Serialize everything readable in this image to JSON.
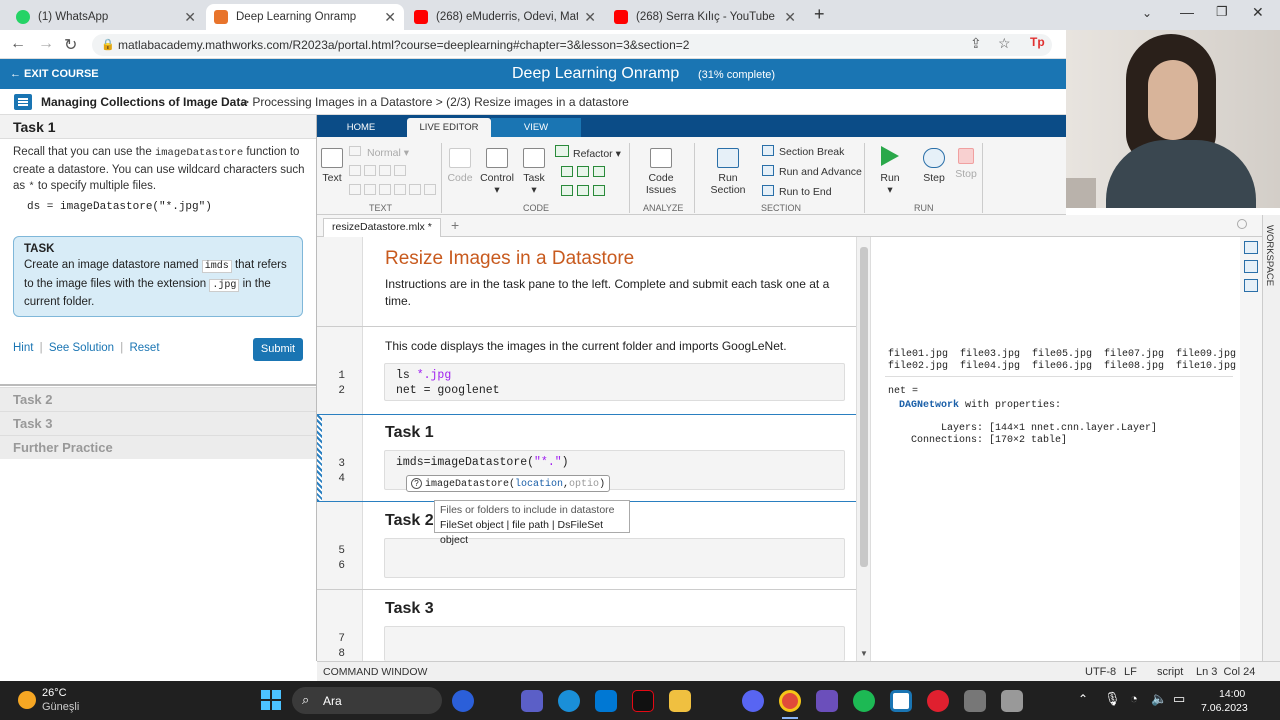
{
  "browser": {
    "tabs": [
      {
        "label": "(1) WhatsApp",
        "color": "#25d366"
      },
      {
        "label": "Deep Learning Onramp",
        "color": "#e8742c"
      },
      {
        "label": "(268) eMuderris, Ödevi, Matlab d",
        "color": "#ff0000"
      },
      {
        "label": "(268) Serra Kılıç - YouTube",
        "color": "#ff0000"
      }
    ],
    "url": "matlabacademy.mathworks.com/R2023a/portal.html?course=deeplearning#chapter=3&lesson=3&section=2"
  },
  "course": {
    "exit_label": "← EXIT COURSE",
    "title": "Deep Learning Onramp",
    "progress": "(31% complete)",
    "breadcrumb_bold": "Managing Collections of Image Data",
    "breadcrumb_rest": "> Processing Images in a Datastore > (2/3) Resize images in a datastore"
  },
  "left_pane": {
    "task_heading": "Task 1",
    "recall_1": "Recall that you can use the",
    "recall_code": "imageDatastore",
    "recall_2": "function to create a datastore. You can use wildcard characters such as",
    "recall_star": "*",
    "recall_3": "to specify multiple files.",
    "example_code": "ds = imageDatastore(\"*.jpg\")",
    "task_box_title": "TASK",
    "task_text_1": "Create an image datastore named",
    "task_chip_1": "imds",
    "task_text_2": "that refers to the image files with the extension",
    "task_chip_2": ".jpg",
    "task_text_3": "in the current folder.",
    "hint": "Hint",
    "see_solution": "See Solution",
    "reset": "Reset",
    "sep": "|",
    "submit": "Submit",
    "other_tasks": [
      "Task 2",
      "Task 3",
      "Further Practice"
    ]
  },
  "toolstrip": {
    "tabs": [
      "HOME",
      "LIVE EDITOR",
      "VIEW"
    ],
    "text_label": "Text",
    "normal_label": "Normal",
    "code_label": "Code",
    "control_label": "Control",
    "task_label": "Task",
    "refactor_label": "Refactor",
    "code_issues_label": "Code Issues",
    "run_section_label": "Run Section",
    "section_break": "Section Break",
    "run_advance": "Run and Advance",
    "run_to_end": "Run to End",
    "run_label": "Run",
    "step_label": "Step",
    "stop_label": "Stop",
    "sections": [
      "TEXT",
      "CODE",
      "ANALYZE",
      "SECTION",
      "RUN"
    ]
  },
  "editor": {
    "file_tab": "resizeDatastore.mlx *",
    "add_tab": "+",
    "title": "Resize Images in a Datastore",
    "intro": "Instructions are in the task pane to the left. Complete and submit each task one at a time.",
    "code_intro": "This code displays the images in the current folder and imports GoogLeNet.",
    "code_line1_cmd": "ls ",
    "code_line1_arg": "*.jpg",
    "code_line2": "net = googlenet",
    "task1_heading": "Task 1",
    "task1_code_a": "imds=imageDatastore(",
    "task1_code_str": "\"*.\"",
    "task1_code_b": ")",
    "autocomplete_fn": "imageDatastore(",
    "autocomplete_p1": "location",
    "autocomplete_comma": ",",
    "autocomplete_p2": "optio",
    "autocomplete_end": ")",
    "help_icon": "?",
    "tooltip_line1": "Files or folders to include in datastore",
    "tooltip_line2": "FileSet object | file path | DsFileSet object",
    "task2_heading": "Task 2",
    "task3_heading": "Task 3",
    "line_numbers": [
      "1",
      "2",
      "3",
      "4",
      "5",
      "6",
      "7",
      "8"
    ]
  },
  "output": {
    "files_row1": "file01.jpg  file03.jpg  file05.jpg  file07.jpg  file09.jpg  fil",
    "files_row2": "file02.jpg  file04.jpg  file06.jpg  file08.jpg  file10.jpg  fil",
    "net_eq": "net =",
    "dag": "DAGNetwork",
    "with_props": " with properties:",
    "layers": "     Layers: [144×1 nnet.cnn.layer.Layer]",
    "connections": "Connections: [170×2 table]"
  },
  "workspace_label": "WORKSPACE",
  "status_bar": {
    "command_window": "COMMAND WINDOW",
    "encoding": "UTF-8",
    "eol": "LF",
    "mode": "script",
    "position": "Ln 3  Col 24"
  },
  "taskbar": {
    "temp": "26°C",
    "weather": "Güneşli",
    "search": "Ara",
    "time": "14:00",
    "date": "7.06.2023"
  }
}
